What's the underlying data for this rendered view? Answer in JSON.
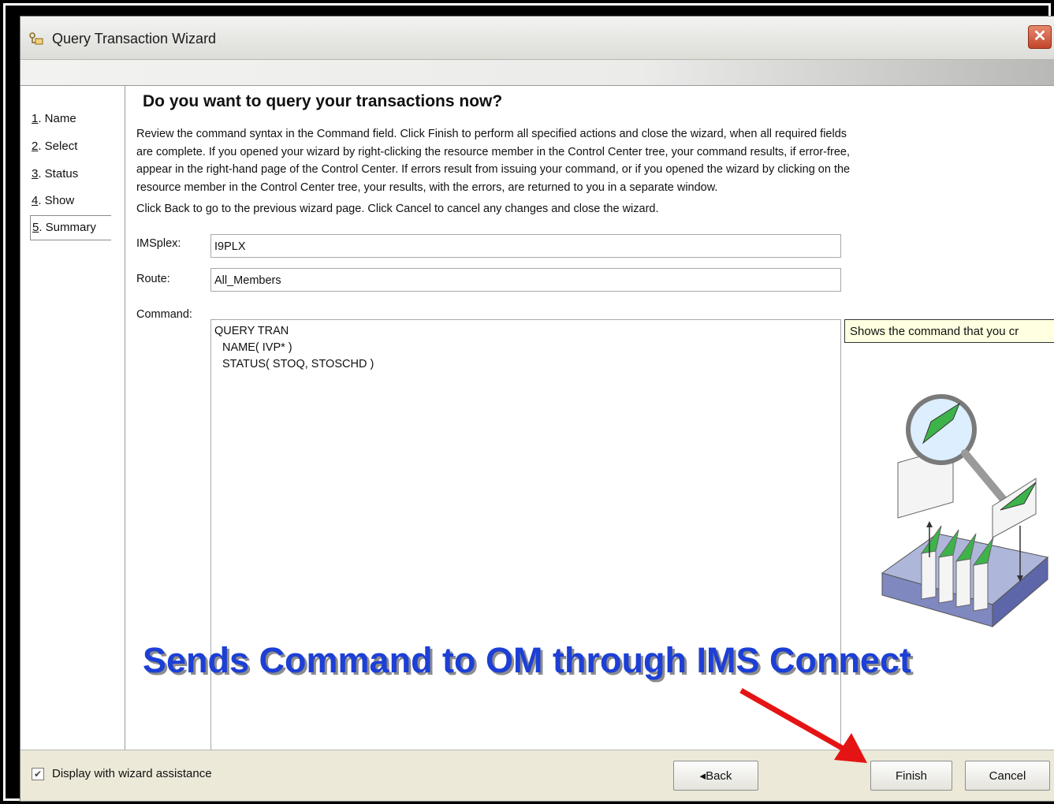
{
  "window": {
    "title": "Query Transaction Wizard"
  },
  "nav": {
    "items": [
      {
        "num": "1",
        "label": ". Name"
      },
      {
        "num": "2",
        "label": ". Select"
      },
      {
        "num": "3",
        "label": ". Status"
      },
      {
        "num": "4",
        "label": ". Show"
      },
      {
        "num": "5",
        "label": ". Summary"
      }
    ],
    "active_index": 4
  },
  "main": {
    "heading": "Do you want to query your transactions now?",
    "para1_line1": "Review the command syntax in the Command field. Click Finish to perform all specified actions and close the wizard, when all required fields",
    "para1_line2": "are complete. If you opened your wizard by right-clicking the resource member in the Control Center tree, your command results, if error-free,",
    "para1_line3": "appear in the right-hand page of the Control Center. If errors result from issuing your command, or if you opened the wizard by clicking on the",
    "para1_line4": "resource member in the Control Center tree, your results, with the errors, are returned to you in a separate window.",
    "para2": "Click Back to go to the previous wizard page. Click Cancel to cancel any changes and close the wizard.",
    "imsplex_label": "IMSplex:",
    "imsplex_value": "I9PLX",
    "route_label": "Route:",
    "route_value": "All_Members",
    "command_label": "Command:",
    "command_line1": "QUERY TRAN",
    "command_line2": "NAME( IVP* )",
    "command_line3": "STATUS( STOQ, STOSCHD )",
    "tooltip": "Shows the command that you cr"
  },
  "footer": {
    "checkbox_checked": true,
    "checkbox_label": "Display with wizard assistance",
    "back_label": "Back",
    "finish_label": "Finish",
    "cancel_label": "Cancel"
  },
  "annotation": {
    "callout": "Sends Command to OM through IMS Connect"
  },
  "colors": {
    "callout": "#1c3fd6",
    "arrow": "#e51414",
    "tooltip_bg": "#ffffe1"
  }
}
